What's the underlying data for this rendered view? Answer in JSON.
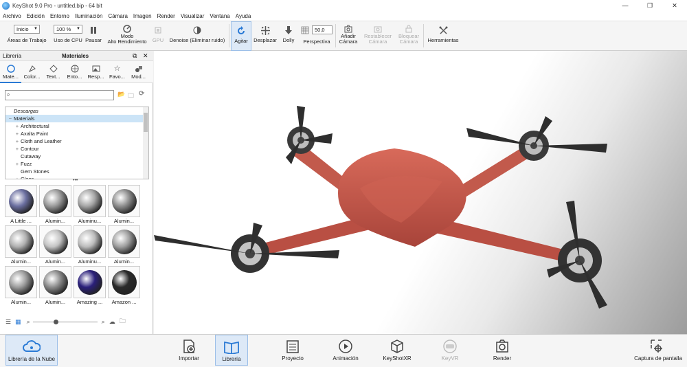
{
  "window": {
    "title": "KeyShot 9.0 Pro  - untitled.bip  - 64 bit",
    "min": "—",
    "max": "❐",
    "close": "✕"
  },
  "menu": [
    "Archivo",
    "Edición",
    "Entorno",
    "Iluminación",
    "Cámara",
    "Imagen",
    "Render",
    "Visualizar",
    "Ventana",
    "Ayuda"
  ],
  "toolbar": {
    "workspace_value": "Inicio",
    "workspace_label": "Áreas de Trabajo",
    "cpu_value": "100 %",
    "cpu_label": "Uso de CPU",
    "pause_label": "Pausar",
    "perf_mode_label": "Modo\nAlto Rendimiento",
    "gpu_label": "GPU",
    "denoise_label": "Denoise (Eliminar ruido)",
    "tumble_label": "Agitar",
    "pan_label": "Desplazar",
    "dolly_label": "Dolly",
    "perspective_value": "50,0",
    "perspective_label": "Perspectiva",
    "add_camera_label": "Añadir\nCámara",
    "reset_camera_label": "Restablecer\nCámara",
    "lock_camera_label": "Bloquear\nCámara",
    "tools_label": "Herramientas"
  },
  "library": {
    "title": "Librería",
    "panel_title": "Materiales",
    "tabs": [
      "Mate...",
      "Color...",
      "Text...",
      "Ento...",
      "Resp...",
      "Favo...",
      "Mod..."
    ],
    "tree": [
      {
        "label": "Descargas",
        "italic": true,
        "pm": ""
      },
      {
        "label": "Materials",
        "selected": true,
        "pm": "−"
      },
      {
        "label": "Architectural",
        "pm": "+"
      },
      {
        "label": "Axalta Paint",
        "pm": "+"
      },
      {
        "label": "Cloth and Leather",
        "pm": "+"
      },
      {
        "label": "Contour",
        "pm": "+"
      },
      {
        "label": "Cutaway",
        "pm": ""
      },
      {
        "label": "Fuzz",
        "pm": "+"
      },
      {
        "label": "Gem Stones",
        "pm": ""
      },
      {
        "label": "Glass",
        "pm": "+"
      }
    ],
    "thumbnails": [
      {
        "label": "A Little ...",
        "color": "#6b6fa0"
      },
      {
        "label": "Alumin...",
        "color": "#9a9a9a"
      },
      {
        "label": "Aluminu...",
        "color": "#a5a5a5"
      },
      {
        "label": "Alumin...",
        "color": "#8e8e8e"
      },
      {
        "label": "Alumin...",
        "color": "#b0b0b0"
      },
      {
        "label": "Alumin...",
        "color": "#c4c4c4"
      },
      {
        "label": "Aluminu...",
        "color": "#bcbcbc"
      },
      {
        "label": "Alumin...",
        "color": "#a0a0a0"
      },
      {
        "label": "Alumin...",
        "color": "#9c9c9c"
      },
      {
        "label": "Alumin...",
        "color": "#8a8a8a"
      },
      {
        "label": "Amazing ...",
        "color": "#2a1f7a"
      },
      {
        "label": "Amazon ...",
        "color": "#2a2a2a"
      }
    ]
  },
  "bottom": {
    "cloud_label": "Librería de la Nube",
    "import_label": "Importar",
    "library_label": "Librería",
    "project_label": "Proyecto",
    "animation_label": "Animación",
    "keyshotxr_label": "KeyShotXR",
    "keyvr_label": "KeyVR",
    "render_label": "Render",
    "screenshot_label": "Captura de pantalla"
  },
  "colors": {
    "accent": "#2a7ad5",
    "drone_body": "#c9584a",
    "drone_dark": "#2e2e2e"
  }
}
